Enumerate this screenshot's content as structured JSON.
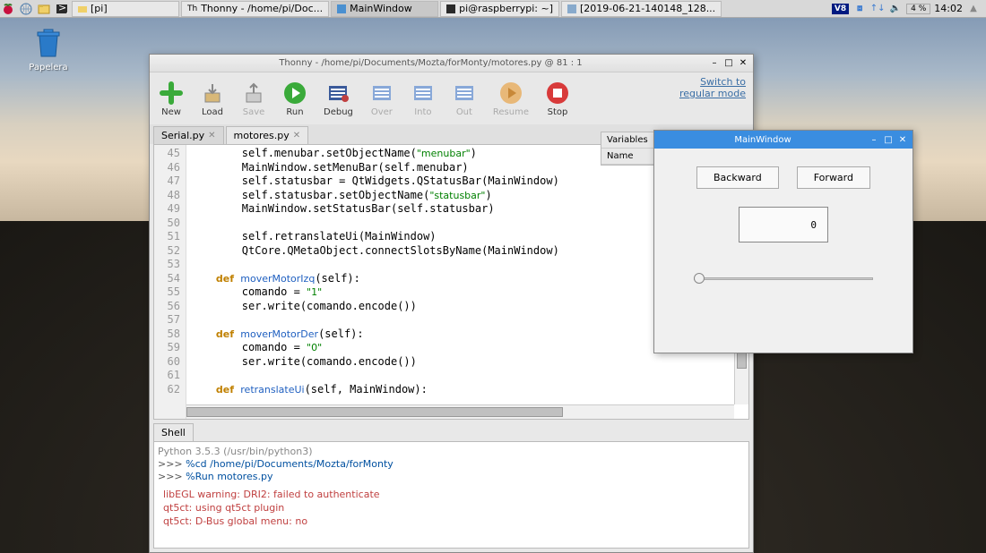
{
  "taskbar": {
    "items": [
      {
        "label": "[pi]"
      },
      {
        "label": "Thonny  -  /home/pi/Doc..."
      },
      {
        "label": "MainWindow"
      },
      {
        "label": "pi@raspberrypi: ~]"
      },
      {
        "label": "[2019-06-21-140148_128..."
      }
    ],
    "vnc": "V8",
    "battery": "4 %",
    "clock": "14:02"
  },
  "desktop": {
    "trash_label": "Papelera"
  },
  "thonny": {
    "title": "Thonny  -  /home/pi/Documents/Mozta/forMonty/motores.py  @  81 : 1",
    "toolbar": {
      "new": "New",
      "load": "Load",
      "save": "Save",
      "run": "Run",
      "debug": "Debug",
      "over": "Over",
      "into": "Into",
      "out": "Out",
      "resume": "Resume",
      "stop": "Stop",
      "switch1": "Switch to",
      "switch2": "regular mode"
    },
    "file_tabs": {
      "serial": "Serial.py",
      "motores": "motores.py"
    },
    "gutter_start": 45,
    "gutter_end": 62,
    "variables": {
      "title": "Variables",
      "col": "Name"
    },
    "shell": {
      "title": "Shell",
      "line1": "Python 3.5.3 (/usr/bin/python3)",
      "p": ">>> ",
      "cmd1": "%cd /home/pi/Documents/Mozta/forMonty",
      "cmd2": "%Run motores.py",
      "err1": "libEGL warning: DRI2: failed to authenticate",
      "err2": "qt5ct: using qt5ct plugin",
      "err3": "qt5ct: D-Bus global menu: no"
    }
  },
  "mainwindow": {
    "title": "MainWindow",
    "backward": "Backward",
    "forward": "Forward",
    "lcd": "0",
    "slider_value": 0
  }
}
